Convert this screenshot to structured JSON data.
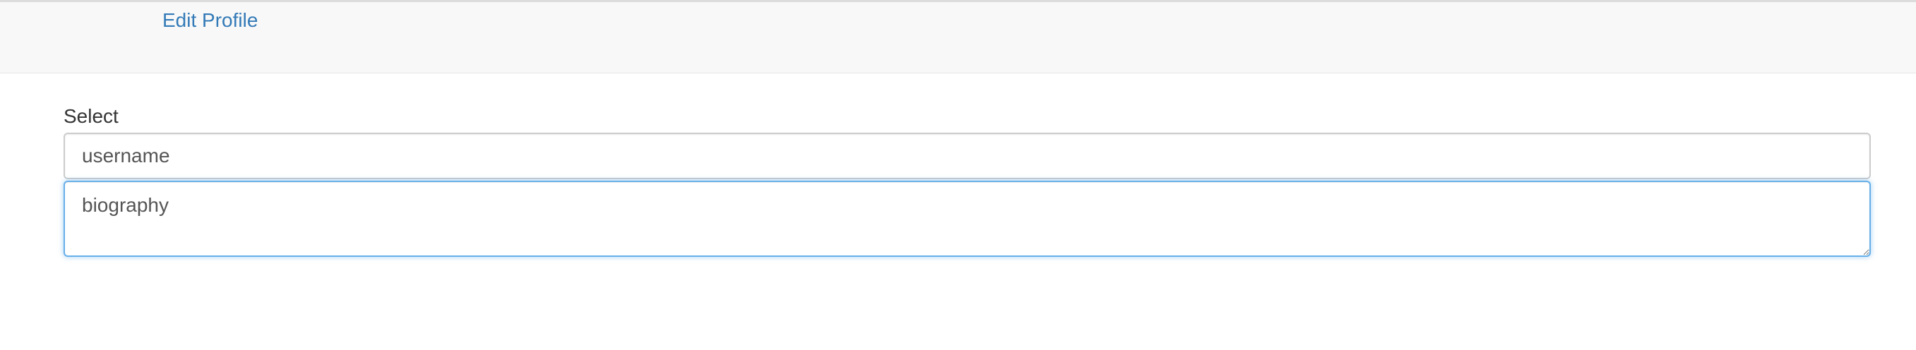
{
  "nav": {
    "edit_profile_label": "Edit Profile"
  },
  "form": {
    "select_label": "Select",
    "username_value": "username",
    "biography_value": "biography"
  },
  "colors": {
    "link": "#337ab7",
    "focus_border": "#66afe9",
    "navbar_bg": "#f8f8f8"
  }
}
